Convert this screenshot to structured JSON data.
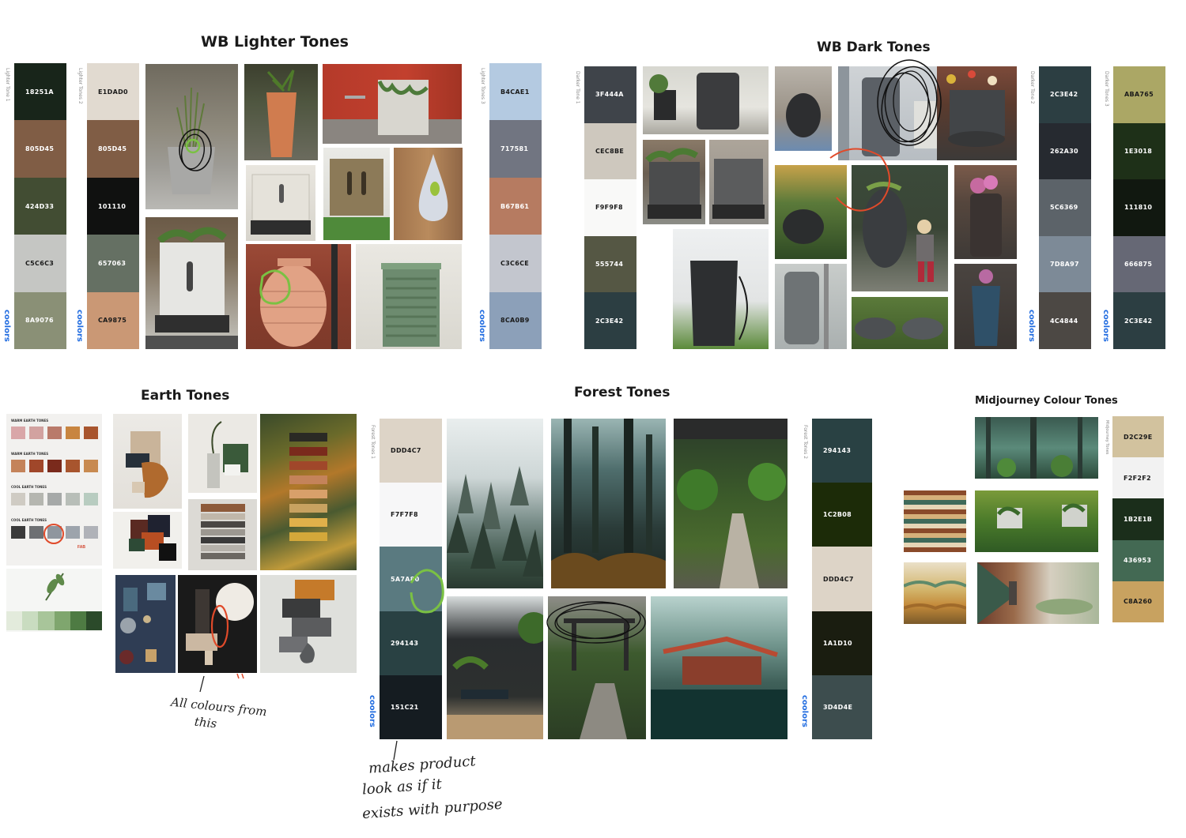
{
  "sections": {
    "wb_lighter": "WB Lighter Tones",
    "wb_dark": "WB Dark Tones",
    "earth": "Earth Tones",
    "forest": "Forest Tones",
    "midjourney": "Midjourney Colour Tones"
  },
  "palette_labels": {
    "lighter1": "Lighter Tone 1",
    "lighter2": "Lighter Tones 2",
    "lighter3": "Lighter Tones 3",
    "darker1": "Darker Tone 1",
    "darker2": "Darker Tone 2",
    "darker3": "Darker Tones 3",
    "forest1": "Forest Tones 1",
    "forest2": "Forest Tones 2",
    "midjourney": "Midjourney Tones"
  },
  "brand": "coolors",
  "palettes": {
    "lighter1": [
      {
        "hex": "18251A",
        "color": "#18251A"
      },
      {
        "hex": "805D45",
        "color": "#805D45"
      },
      {
        "hex": "424D33",
        "color": "#424D33"
      },
      {
        "hex": "C5C6C3",
        "color": "#C5C6C3"
      },
      {
        "hex": "8A9076",
        "color": "#8A9076"
      }
    ],
    "lighter2": [
      {
        "hex": "E1DAD0",
        "color": "#E1DAD0"
      },
      {
        "hex": "805D45",
        "color": "#805D45"
      },
      {
        "hex": "101110",
        "color": "#101110"
      },
      {
        "hex": "657063",
        "color": "#657063"
      },
      {
        "hex": "CA9875",
        "color": "#CA9875"
      }
    ],
    "lighter3": [
      {
        "hex": "B4CAE1",
        "color": "#B4CAE1"
      },
      {
        "hex": "717581",
        "color": "#717581"
      },
      {
        "hex": "B67B61",
        "color": "#B67B61"
      },
      {
        "hex": "C3C6CE",
        "color": "#C3C6CE"
      },
      {
        "hex": "8CA0B9",
        "color": "#8CA0B9"
      }
    ],
    "darker1": [
      {
        "hex": "3F444A",
        "color": "#3F444A"
      },
      {
        "hex": "CEC8BE",
        "color": "#CEC8BE"
      },
      {
        "hex": "F9F9F8",
        "color": "#F9F9F8"
      },
      {
        "hex": "555744",
        "color": "#555744"
      },
      {
        "hex": "2C3E42",
        "color": "#2C3E42"
      }
    ],
    "darker2": [
      {
        "hex": "2C3E42",
        "color": "#2C3E42"
      },
      {
        "hex": "262A30",
        "color": "#262A30"
      },
      {
        "hex": "5C6369",
        "color": "#5C6369"
      },
      {
        "hex": "7D8A97",
        "color": "#7D8A97"
      },
      {
        "hex": "4C4844",
        "color": "#4C4844"
      }
    ],
    "darker3": [
      {
        "hex": "ABA765",
        "color": "#ABA765"
      },
      {
        "hex": "1E3018",
        "color": "#1E3018"
      },
      {
        "hex": "111810",
        "color": "#111810"
      },
      {
        "hex": "666875",
        "color": "#666875"
      },
      {
        "hex": "2C3E42",
        "color": "#2C3E42"
      }
    ],
    "forest1": [
      {
        "hex": "DDD4C7",
        "color": "#DDD4C7"
      },
      {
        "hex": "F7F7F8",
        "color": "#F7F7F8"
      },
      {
        "hex": "5A7A80",
        "color": "#5A7A80"
      },
      {
        "hex": "294143",
        "color": "#294143"
      },
      {
        "hex": "151C21",
        "color": "#151C21"
      }
    ],
    "forest2": [
      {
        "hex": "294143",
        "color": "#294143"
      },
      {
        "hex": "1C2B08",
        "color": "#1C2B08"
      },
      {
        "hex": "DDD4C7",
        "color": "#DDD4C7"
      },
      {
        "hex": "1A1D10",
        "color": "#1A1D10"
      },
      {
        "hex": "3D4D4E",
        "color": "#3D4D4E"
      }
    ],
    "midjourney": [
      {
        "hex": "D2C29E",
        "color": "#D2C29E"
      },
      {
        "hex": "F2F2F2",
        "color": "#F2F2F2"
      },
      {
        "hex": "1B2E1B",
        "color": "#1B2E1B"
      },
      {
        "hex": "436953",
        "color": "#436953"
      },
      {
        "hex": "C8A260",
        "color": "#C8A260"
      }
    ]
  },
  "earth_chart": {
    "groups": [
      {
        "label": "WARM EARTH TONES",
        "colors": [
          "#D9A6A8",
          "#D2A2A0",
          "#B97A6A",
          "#C88540",
          "#A8552E"
        ]
      },
      {
        "label": "WARM EARTH TONES",
        "colors": [
          "#C4835A",
          "#A0472A",
          "#7A2A1C",
          "#A8552E",
          "#C88A50"
        ]
      },
      {
        "label": "COOL EARTH TONES",
        "colors": [
          "#CFCBC3",
          "#B5B6B0",
          "#A6A9A8",
          "#B8BEB8",
          "#B8CCC0"
        ]
      },
      {
        "label": "COOL EARTH TONES",
        "colors": [
          "#3A3A3A",
          "#6E7073",
          "#8F969E",
          "#9DA4AC",
          "#B0B2B8"
        ]
      }
    ],
    "greens": [
      "#E3EBDC",
      "#C9DCC0",
      "#A8C59A",
      "#7FA66E",
      "#4E7B43",
      "#2B4A2A"
    ]
  },
  "handwritten": {
    "earth_note_line1": "All colours from",
    "earth_note_line2": "this",
    "forest_note_line1": "makes product",
    "forest_note_line2": "look as if it",
    "forest_note_line3": "exists with purpose"
  }
}
